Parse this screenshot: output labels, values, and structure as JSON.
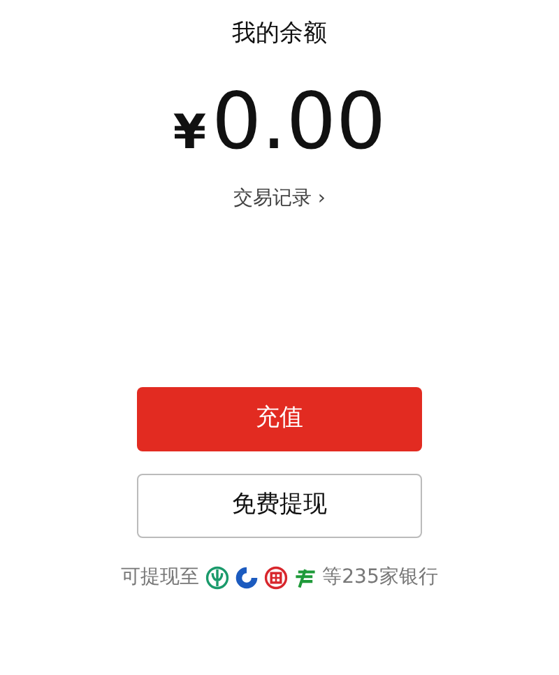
{
  "title": "我的余额",
  "balance": {
    "currency": "¥",
    "amount": "0.00"
  },
  "history_link": {
    "label": "交易记录",
    "arrow": "›"
  },
  "buttons": [
    {
      "label": "充值",
      "kind": "primary"
    },
    {
      "label": "免费提现",
      "kind": "outline"
    }
  ],
  "withdraw_info": {
    "prefix": "可提现至",
    "suffix": "等235家银行",
    "banks": [
      {
        "kind": "wheat",
        "color": "#1a9a6b"
      },
      {
        "kind": "c",
        "color": "#1c5bbf"
      },
      {
        "kind": "seal",
        "color": "#d8262c"
      },
      {
        "kind": "post",
        "color": "#1f9a3a"
      }
    ]
  }
}
